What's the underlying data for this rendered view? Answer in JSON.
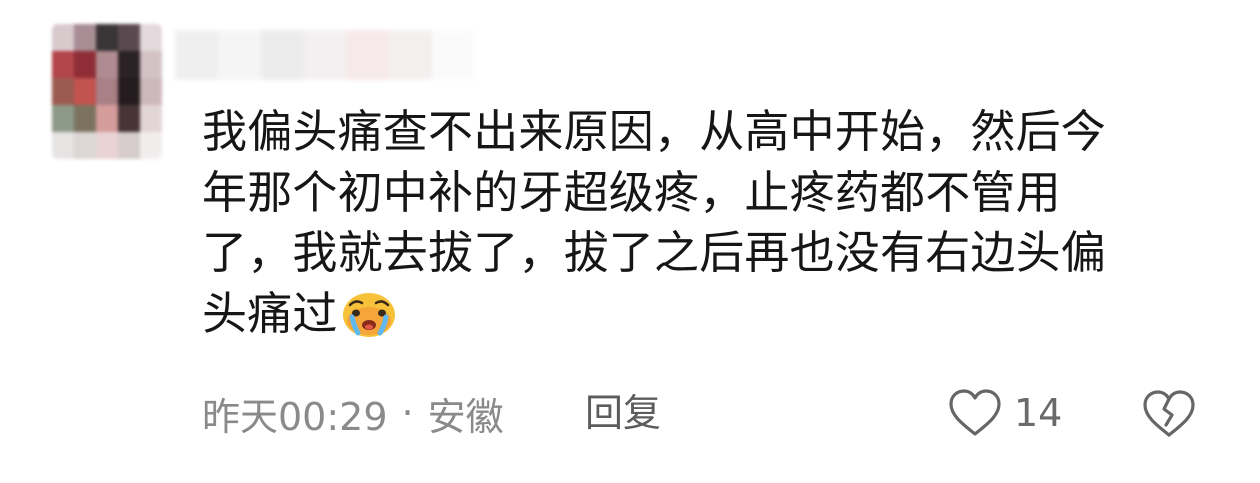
{
  "comment": {
    "text": "我偏头痛查不出来原因，从高中开始，然后今\n年那个初中补的牙超级疼，止疼药都不管用\n了，我就去拔了，拔了之后再也没有右边头偏\n头痛过",
    "emoji": "crying-face-emoji"
  },
  "meta": {
    "time": "昨天00:29",
    "separator": "·",
    "location": "安徽",
    "reply_label": "回复",
    "like_count": "14"
  },
  "icons": {
    "like": "heart-outline-icon",
    "dislike": "broken-heart-outline-icon"
  },
  "colors": {
    "text": "#161616",
    "meta_text": "#8a8a8a",
    "reply_text": "#5c5c5c",
    "icon_stroke": "#666666"
  }
}
